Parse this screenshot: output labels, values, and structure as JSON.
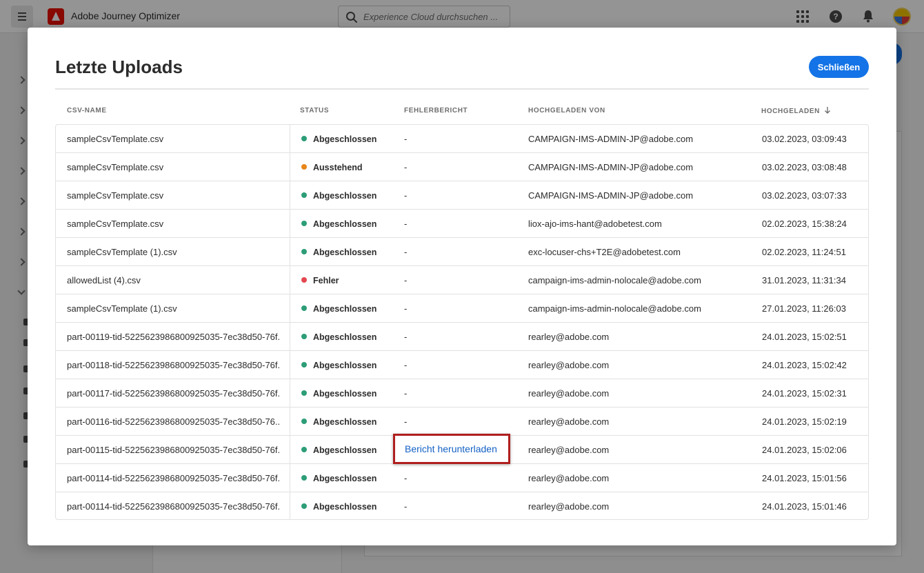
{
  "app": {
    "name": "Adobe Journey Optimizer",
    "search_placeholder": "Experience Cloud durchsuchen ...",
    "icons": [
      "menu-icon",
      "adobe-logo",
      "search-icon",
      "apps-grid-icon",
      "help-icon",
      "bell-icon",
      "avatar"
    ]
  },
  "modal": {
    "title": "Letzte Uploads",
    "close_label": "Schließen",
    "columns": {
      "csv_name": "CSV-NAME",
      "status": "STATUS",
      "error_report": "FEHLERBERICHT",
      "uploaded_by": "HOCHGELADEN VON",
      "uploaded": "HOCHGELADEN"
    },
    "sort_column": "uploaded",
    "sort_direction": "descending"
  },
  "status_colors": {
    "Abgeschlossen": "#2d9d78",
    "Ausstehend": "#e68619",
    "Fehler": "#e34850"
  },
  "rows": [
    {
      "name": "sampleCsvTemplate.csv",
      "status": "Abgeschlossen",
      "report": "-",
      "user": "CAMPAIGN-IMS-ADMIN-JP@adobe.com",
      "date": "03.02.2023, 03:09:43"
    },
    {
      "name": "sampleCsvTemplate.csv",
      "status": "Ausstehend",
      "report": "-",
      "user": "CAMPAIGN-IMS-ADMIN-JP@adobe.com",
      "date": "03.02.2023, 03:08:48"
    },
    {
      "name": "sampleCsvTemplate.csv",
      "status": "Abgeschlossen",
      "report": "-",
      "user": "CAMPAIGN-IMS-ADMIN-JP@adobe.com",
      "date": "03.02.2023, 03:07:33"
    },
    {
      "name": "sampleCsvTemplate.csv",
      "status": "Abgeschlossen",
      "report": "-",
      "user": "liox-ajo-ims-hant@adobetest.com",
      "date": "02.02.2023, 15:38:24"
    },
    {
      "name": "sampleCsvTemplate (1).csv",
      "status": "Abgeschlossen",
      "report": "-",
      "user": "exc-locuser-chs+T2E@adobetest.com",
      "date": "02.02.2023, 11:24:51"
    },
    {
      "name": "allowedList (4).csv",
      "status": "Fehler",
      "report": "-",
      "user": "campaign-ims-admin-nolocale@adobe.com",
      "date": "31.01.2023,  11:31:34"
    },
    {
      "name": "sampleCsvTemplate (1).csv",
      "status": "Abgeschlossen",
      "report": "-",
      "user": "campaign-ims-admin-nolocale@adobe.com",
      "date": "27.01.2023,  11:26:03"
    },
    {
      "name": "part-00119-tid-5225623986800925035-7ec38d50-76f...",
      "status": "Abgeschlossen",
      "report": "-",
      "user": "rearley@adobe.com",
      "date": "24.01.2023,  15:02:51"
    },
    {
      "name": "part-00118-tid-5225623986800925035-7ec38d50-76f...",
      "status": "Abgeschlossen",
      "report": "-",
      "user": "rearley@adobe.com",
      "date": "24.01.2023,  15:02:42"
    },
    {
      "name": "part-00117-tid-5225623986800925035-7ec38d50-76f...",
      "status": "Abgeschlossen",
      "report": "-",
      "user": "rearley@adobe.com",
      "date": "24.01.2023,  15:02:31"
    },
    {
      "name": "part-00116-tid-5225623986800925035-7ec38d50-76...",
      "status": "Abgeschlossen",
      "report": "-",
      "user": "rearley@adobe.com",
      "date": "24.01.2023,  15:02:19"
    },
    {
      "name": "part-00115-tid-5225623986800925035-7ec38d50-76f...",
      "status": "Abgeschlossen",
      "report": "Bericht herunterladen",
      "report_is_link": true,
      "user": "rearley@adobe.com",
      "date": "24.01.2023,  15:02:06"
    },
    {
      "name": "part-00114-tid-5225623986800925035-7ec38d50-76f...",
      "status": "Abgeschlossen",
      "report": "-",
      "user": "rearley@adobe.com",
      "date": "24.01.2023,  15:01:56"
    },
    {
      "name": "part-00114-tid-5225623986800925035-7ec38d50-76f...",
      "status": "Abgeschlossen",
      "report": "-",
      "user": "rearley@adobe.com",
      "date": "24.01.2023,  15:01:46"
    }
  ]
}
